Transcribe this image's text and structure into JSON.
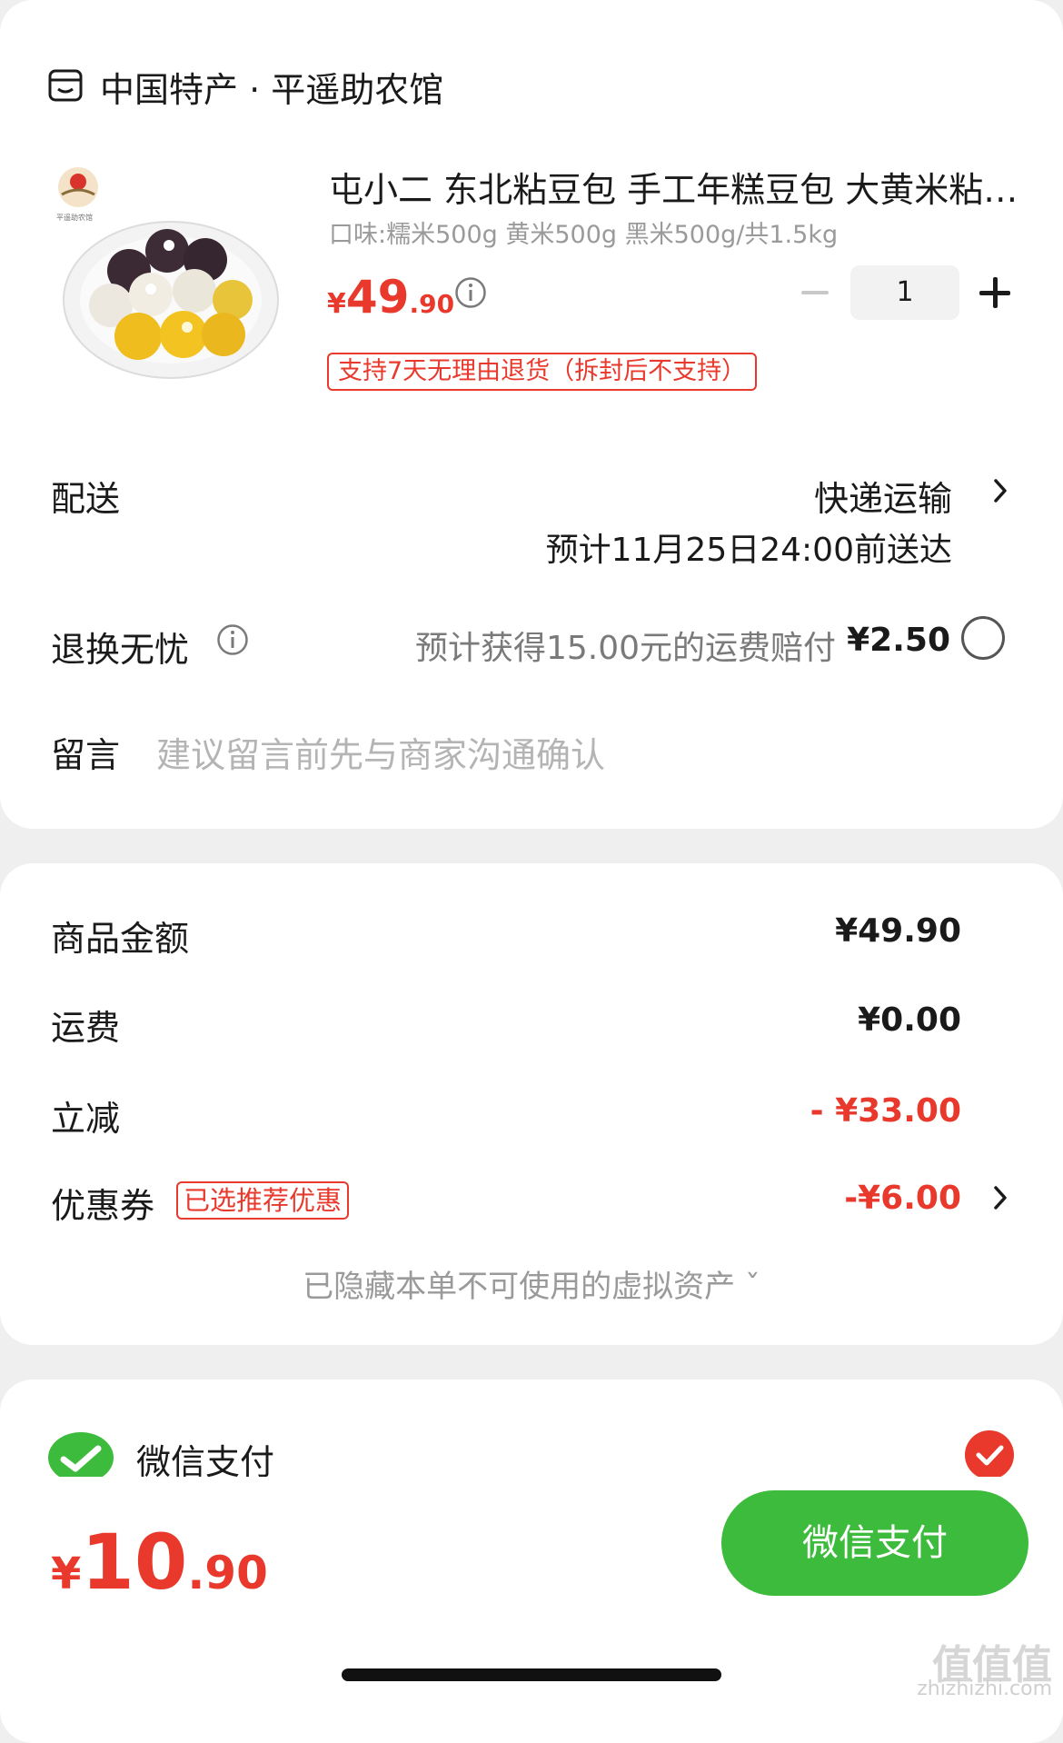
{
  "shop": {
    "name": "中国特产 · 平遥助农馆",
    "icon": "shop-icon"
  },
  "product": {
    "title": "屯小二 东北粘豆包 手工年糕豆包 大黄米粘豆包",
    "spec": "口味:糯米500g 黄米500g 黑米500g/共1.5kg",
    "price_symbol": "¥",
    "price_int": "49",
    "price_dec": ".90",
    "quantity": "1",
    "return_policy": "支持7天无理由退货（拆封后不支持）",
    "image_brand_text": "平遥助农馆"
  },
  "delivery": {
    "label": "配送",
    "method": "快递运输",
    "estimate": "预计11月25日24:00前送达"
  },
  "worry_free": {
    "label": "退换无忧",
    "description": "预计获得15.00元的运费赔付",
    "price": "¥2.50",
    "selected": false
  },
  "message": {
    "label": "留言",
    "placeholder": "建议留言前先与商家沟通确认"
  },
  "summary": {
    "goods_label": "商品金额",
    "goods_value": "¥49.90",
    "shipping_label": "运费",
    "shipping_value": "¥0.00",
    "discount_label": "立减",
    "discount_value": "- ¥33.00",
    "coupon_label": "优惠券",
    "coupon_tag": "已选推荐优惠",
    "coupon_value": "-¥6.00",
    "hidden_assets": "已隐藏本单不可使用的虚拟资产 ˇ"
  },
  "payment": {
    "method": "微信支付",
    "selected": true,
    "total_symbol": "¥",
    "total_int": "10",
    "total_dec": ".90",
    "pay_button": "微信支付"
  },
  "watermark": {
    "main": "值值值",
    "sub": "zhizhizhi.com"
  },
  "colors": {
    "accent_red": "#e8392c",
    "wechat_green": "#3dbb3c"
  }
}
